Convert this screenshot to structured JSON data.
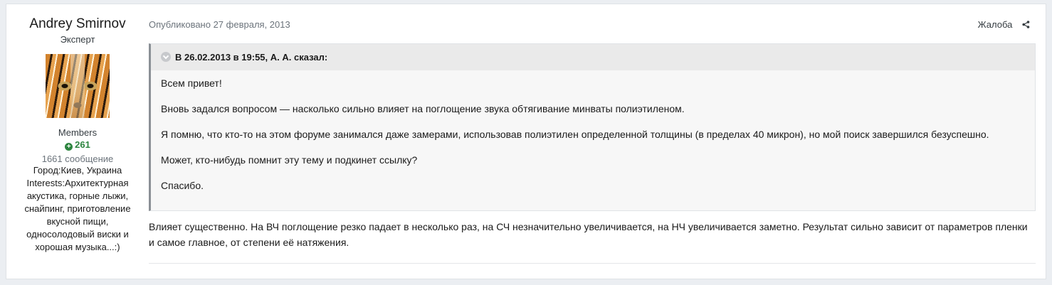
{
  "author": {
    "name": "Andrey Smirnov",
    "title": "Эксперт",
    "group": "Members",
    "reputation": "261",
    "post_count": "1661 сообщение",
    "city": "Город:Киев, Украина",
    "interests": "Interests:Архитектурная акустика, горные лыжи, снайпинг, приготовление вкусной пищи, односолодовый виски и хорошая музыка...:)"
  },
  "post": {
    "published": "Опубликовано 27 февраля, 2013",
    "report_label": "Жалоба",
    "quote": {
      "header": "В 26.02.2013 в 19:55, А. А. сказал:",
      "paragraphs": [
        "Всем привет!",
        "Вновь задался вопросом — насколько сильно влияет на поглощение звука обтягивание минваты полиэтиленом.",
        "Я помню, что кто-то на этом форуме занимался даже замерами, использовав полиэтилен определенной толщины (в пределах 40 микрон), но мой поиск завершился безуспешно.",
        "Может, кто-нибудь помнит эту тему и подкинет ссылку?",
        "Спасибо."
      ]
    },
    "reply": "Влияет существенно. На ВЧ поглощение резко падает в несколько раз, на СЧ незначительно увеличивается, на НЧ увеличивается заметно. Результат сильно зависит от параметров пленки и самое главное, от степени её натяжения."
  },
  "colors": {
    "reputation_green": "#2e8540",
    "quote_border": "#8b9096",
    "page_bg": "#ebeef2"
  }
}
